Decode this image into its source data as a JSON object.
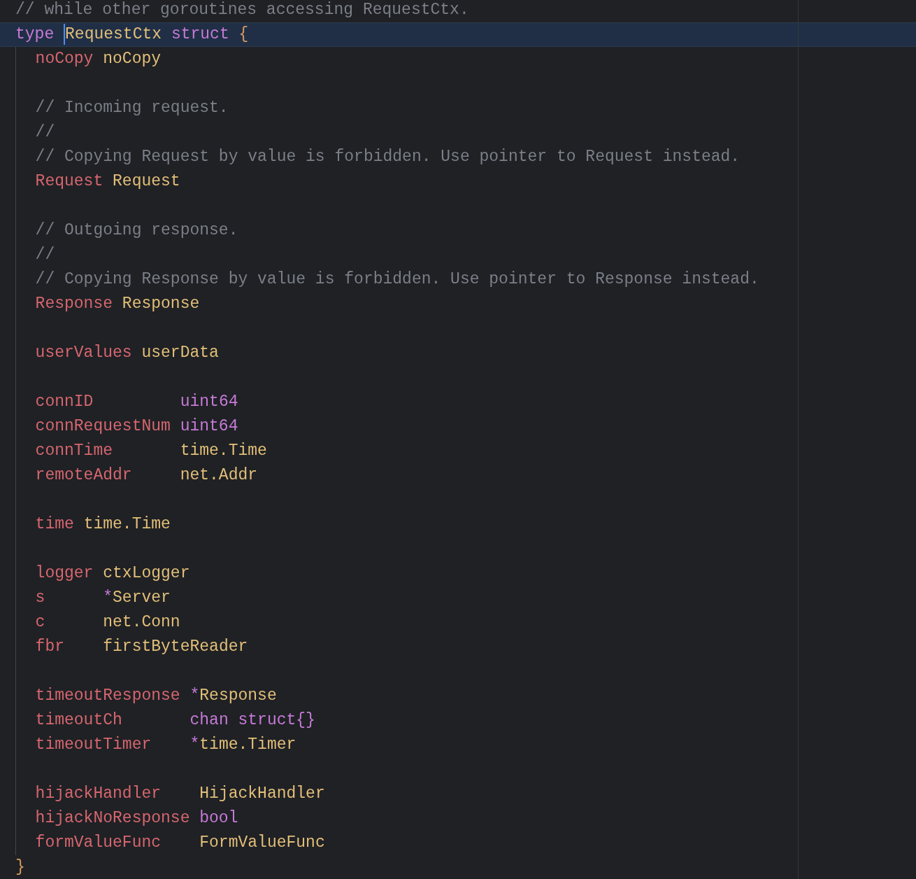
{
  "editor": {
    "lines": [
      {
        "kind": "code",
        "current": false,
        "tokens": [
          {
            "kind": "comment",
            "text": "// while other goroutines accessing RequestCtx."
          }
        ]
      },
      {
        "kind": "code",
        "current": true,
        "tokens": [
          {
            "kind": "keyword",
            "text": "type "
          },
          {
            "kind": "caret"
          },
          {
            "kind": "type",
            "text": "RequestCtx "
          },
          {
            "kind": "keyword",
            "text": "struct "
          },
          {
            "kind": "brace",
            "text": "{"
          }
        ]
      },
      {
        "kind": "block",
        "lines": [
          {
            "kind": "code",
            "current": false,
            "tokens": [
              {
                "kind": "field",
                "text": "  noCopy "
              },
              {
                "kind": "type",
                "text": "noCopy"
              }
            ]
          },
          {
            "kind": "blank"
          },
          {
            "kind": "code",
            "current": false,
            "tokens": [
              {
                "kind": "comment",
                "text": "  // Incoming request."
              }
            ]
          },
          {
            "kind": "code",
            "current": false,
            "tokens": [
              {
                "kind": "comment",
                "text": "  //"
              }
            ]
          },
          {
            "kind": "code",
            "current": false,
            "tokens": [
              {
                "kind": "comment",
                "text": "  // Copying Request by value is forbidden. Use pointer to Request instead."
              }
            ]
          },
          {
            "kind": "code",
            "current": false,
            "tokens": [
              {
                "kind": "field",
                "text": "  Request "
              },
              {
                "kind": "type",
                "text": "Request"
              }
            ]
          },
          {
            "kind": "blank"
          },
          {
            "kind": "code",
            "current": false,
            "tokens": [
              {
                "kind": "comment",
                "text": "  // Outgoing response."
              }
            ]
          },
          {
            "kind": "code",
            "current": false,
            "tokens": [
              {
                "kind": "comment",
                "text": "  //"
              }
            ]
          },
          {
            "kind": "code",
            "current": false,
            "tokens": [
              {
                "kind": "comment",
                "text": "  // Copying Response by value is forbidden. Use pointer to Response instead."
              }
            ]
          },
          {
            "kind": "code",
            "current": false,
            "tokens": [
              {
                "kind": "field",
                "text": "  Response "
              },
              {
                "kind": "type",
                "text": "Response"
              }
            ]
          },
          {
            "kind": "blank"
          },
          {
            "kind": "code",
            "current": false,
            "tokens": [
              {
                "kind": "field",
                "text": "  userValues "
              },
              {
                "kind": "type",
                "text": "userData"
              }
            ]
          },
          {
            "kind": "blank"
          },
          {
            "kind": "code",
            "current": false,
            "tokens": [
              {
                "kind": "field",
                "text": "  connID         "
              },
              {
                "kind": "keyword",
                "text": "uint64"
              }
            ]
          },
          {
            "kind": "code",
            "current": false,
            "tokens": [
              {
                "kind": "field",
                "text": "  connRequestNum "
              },
              {
                "kind": "keyword",
                "text": "uint64"
              }
            ]
          },
          {
            "kind": "code",
            "current": false,
            "tokens": [
              {
                "kind": "field",
                "text": "  connTime       "
              },
              {
                "kind": "type",
                "text": "time.Time"
              }
            ]
          },
          {
            "kind": "code",
            "current": false,
            "tokens": [
              {
                "kind": "field",
                "text": "  remoteAddr     "
              },
              {
                "kind": "type",
                "text": "net.Addr"
              }
            ]
          },
          {
            "kind": "blank"
          },
          {
            "kind": "code",
            "current": false,
            "tokens": [
              {
                "kind": "field",
                "text": "  time "
              },
              {
                "kind": "type",
                "text": "time.Time"
              }
            ]
          },
          {
            "kind": "blank"
          },
          {
            "kind": "code",
            "current": false,
            "tokens": [
              {
                "kind": "field",
                "text": "  logger "
              },
              {
                "kind": "type",
                "text": "ctxLogger"
              }
            ]
          },
          {
            "kind": "code",
            "current": false,
            "tokens": [
              {
                "kind": "field",
                "text": "  s      "
              },
              {
                "kind": "keyword",
                "text": "*"
              },
              {
                "kind": "type",
                "text": "Server"
              }
            ]
          },
          {
            "kind": "code",
            "current": false,
            "tokens": [
              {
                "kind": "field",
                "text": "  c      "
              },
              {
                "kind": "type",
                "text": "net.Conn"
              }
            ]
          },
          {
            "kind": "code",
            "current": false,
            "tokens": [
              {
                "kind": "field",
                "text": "  fbr    "
              },
              {
                "kind": "type",
                "text": "firstByteReader"
              }
            ]
          },
          {
            "kind": "blank"
          },
          {
            "kind": "code",
            "current": false,
            "tokens": [
              {
                "kind": "field",
                "text": "  timeoutResponse "
              },
              {
                "kind": "keyword",
                "text": "*"
              },
              {
                "kind": "type",
                "text": "Response"
              }
            ]
          },
          {
            "kind": "code",
            "current": false,
            "tokens": [
              {
                "kind": "field",
                "text": "  timeoutCh       "
              },
              {
                "kind": "keyword",
                "text": "chan struct{}"
              }
            ]
          },
          {
            "kind": "code",
            "current": false,
            "tokens": [
              {
                "kind": "field",
                "text": "  timeoutTimer    "
              },
              {
                "kind": "keyword",
                "text": "*"
              },
              {
                "kind": "type",
                "text": "time.Timer"
              }
            ]
          },
          {
            "kind": "blank"
          },
          {
            "kind": "code",
            "current": false,
            "tokens": [
              {
                "kind": "field",
                "text": "  hijackHandler    "
              },
              {
                "kind": "type",
                "text": "HijackHandler"
              }
            ]
          },
          {
            "kind": "code",
            "current": false,
            "tokens": [
              {
                "kind": "field",
                "text": "  hijackNoResponse "
              },
              {
                "kind": "keyword",
                "text": "bool"
              }
            ]
          },
          {
            "kind": "code",
            "current": false,
            "tokens": [
              {
                "kind": "field",
                "text": "  formValueFunc    "
              },
              {
                "kind": "type",
                "text": "FormValueFunc"
              }
            ]
          }
        ]
      },
      {
        "kind": "code",
        "current": false,
        "tokens": [
          {
            "kind": "brace",
            "text": "}"
          }
        ]
      }
    ]
  }
}
